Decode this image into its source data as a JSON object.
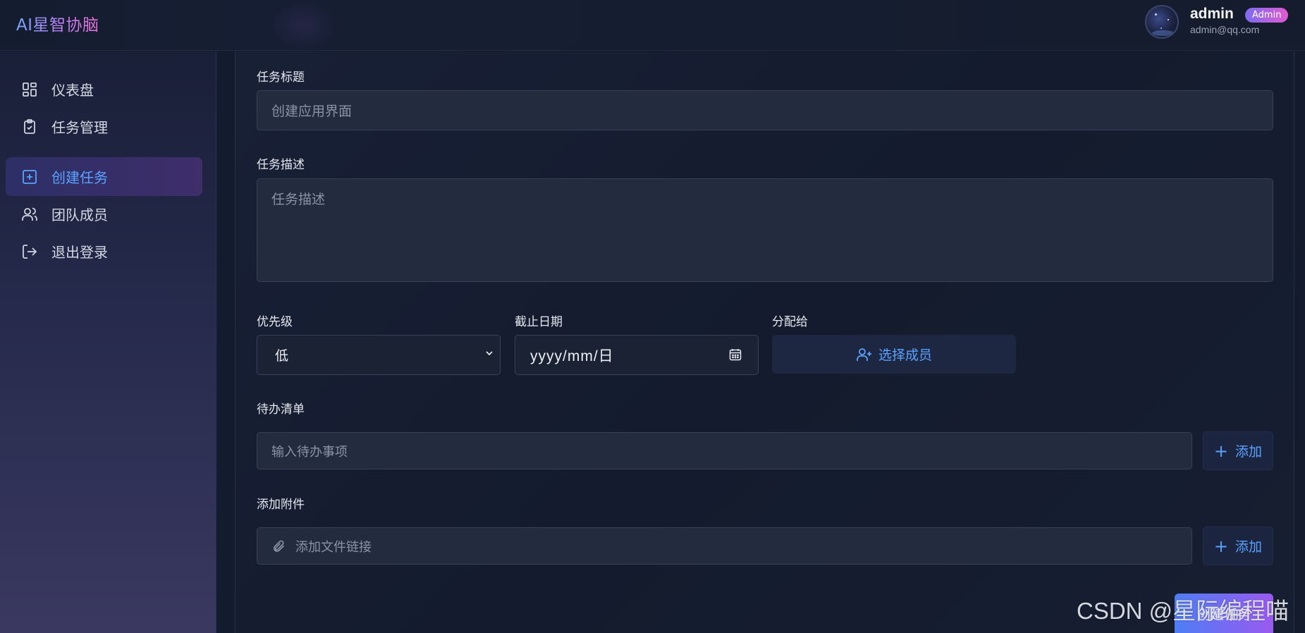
{
  "app": {
    "brand": "AI星智协脑"
  },
  "user": {
    "name": "admin",
    "role": "Admin",
    "email": "admin@qq.com"
  },
  "sidebar": {
    "items": [
      {
        "label": "仪表盘",
        "icon": "dashboard-grid-icon",
        "active": false
      },
      {
        "label": "任务管理",
        "icon": "clipboard-check-icon",
        "active": false
      },
      {
        "label": "创建任务",
        "icon": "plus-square-icon",
        "active": true
      },
      {
        "label": "团队成员",
        "icon": "users-icon",
        "active": false
      },
      {
        "label": "退出登录",
        "icon": "logout-icon",
        "active": false
      }
    ]
  },
  "form": {
    "title_label": "任务标题",
    "title_placeholder": "创建应用界面",
    "description_label": "任务描述",
    "description_placeholder": "任务描述",
    "priority_label": "优先级",
    "priority_value": "低",
    "due_label": "截止日期",
    "due_placeholder": "yyyy/mm/日",
    "assign_label": "分配给",
    "assign_button": "选择成员",
    "todo_label": "待办清单",
    "todo_placeholder": "输入待办事项",
    "todo_add": "添加",
    "attach_label": "添加附件",
    "attach_placeholder": "添加文件链接",
    "attach_add": "添加",
    "submit": "创建任务"
  },
  "watermark": "CSDN @星际编程喵",
  "colors": {
    "accent": "#5aa2ff",
    "background": "#131c2e",
    "field_bg": "#232c3f",
    "brand_gradient_start": "#7aa5ff",
    "brand_gradient_end": "#e870d0"
  }
}
